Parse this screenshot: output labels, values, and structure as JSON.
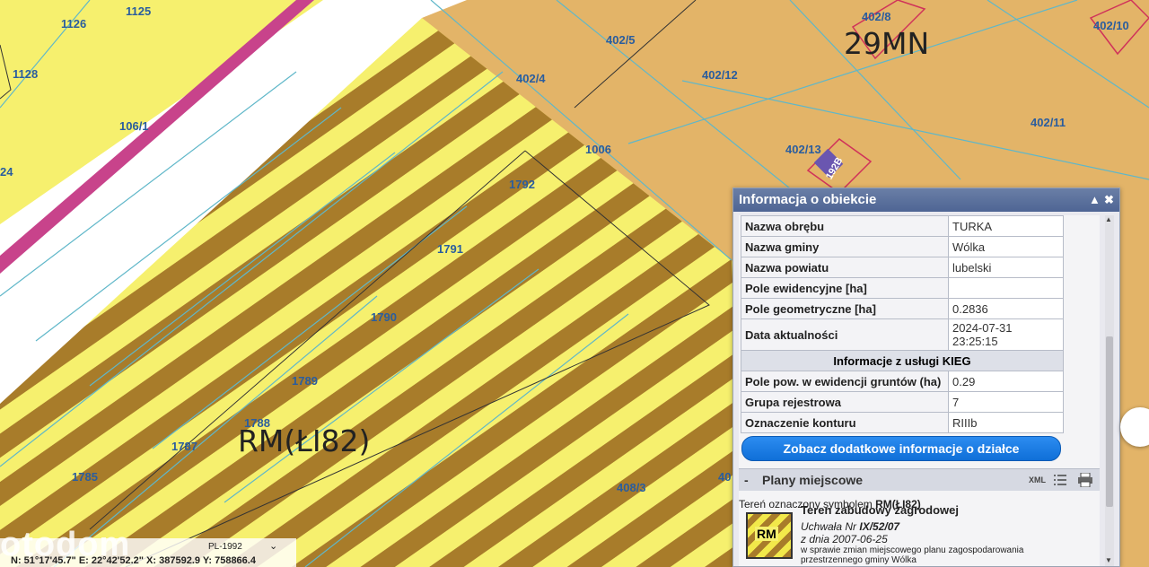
{
  "map": {
    "parcel_labels": [
      "1125",
      "1126",
      "1128",
      "106/1",
      "24",
      "402/4",
      "402/5",
      "402/8",
      "402/10",
      "402/11",
      "402/12",
      "402/13",
      "1006",
      "1792",
      "1791",
      "1790",
      "1789",
      "1788",
      "1787",
      "1785",
      "408/3",
      "40"
    ],
    "zone_labels": [
      "29MN",
      "RM(ŁI82)"
    ],
    "building_label": "192B",
    "marker_m": "m"
  },
  "panel": {
    "title": "Informacja o obiekcie",
    "rows": [
      {
        "key": "Nazwa obrębu",
        "value": "TURKA"
      },
      {
        "key": "Nazwa gminy",
        "value": "Wólka"
      },
      {
        "key": "Nazwa powiatu",
        "value": "lubelski"
      },
      {
        "key": "Pole ewidencyjne [ha]",
        "value": ""
      },
      {
        "key": "Pole geometryczne [ha]",
        "value": "0.2836"
      },
      {
        "key": "Data aktualności",
        "value": "2024-07-31 23:25:15"
      }
    ],
    "kieg_header": "Informacje z usługi KIEG",
    "kieg_rows": [
      {
        "key": "Pole pow. w ewidencji gruntów (ha)",
        "value": "0.29"
      },
      {
        "key": "Grupa rejestrowa",
        "value": "7"
      },
      {
        "key": "Oznaczenie konturu",
        "value": "RIIIb"
      }
    ],
    "more_button": "Zobacz dodatkowe informacje o działce",
    "plany": {
      "minus": "-",
      "title": "Plany miejscowe",
      "xml": "XML",
      "teren_prefix": "Tereń oznaczony symbolem ",
      "teren_symbol": "RM(ŁI82)",
      "icon_label": "RM",
      "name": "Teren zabudowy zagrodowej",
      "uchwala_prefix": "Uchwała Nr ",
      "uchwala_nr": "IX/52/07",
      "date": "z dnia 2007-06-25",
      "desc1": "w sprawie zmian miejscowego planu zagospodarowania",
      "desc2": "przestrzennego gminy Wólka"
    }
  },
  "coords": {
    "crs": "PL-1992",
    "text": "N: 51°17'45.7\"  E: 22°42'52.2\"  X: 387592.9   Y: 758866.4"
  },
  "watermark": "otodom",
  "colors": {
    "zone_yellow": "#f6f06e",
    "zone_orange": "#e3b468",
    "stripe_brown": "#a87c2a",
    "road_pink": "#c8438b",
    "parcel_line": "#5fb7c9",
    "button_blue": "#1a7fe8"
  }
}
